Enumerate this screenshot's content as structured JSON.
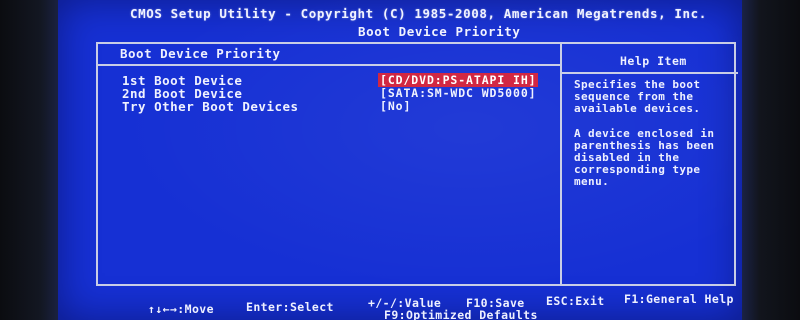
{
  "header": {
    "title": "CMOS Setup Utility - Copyright (C) 1985-2008, American Megatrends, Inc.",
    "subtitle": "Boot Device Priority"
  },
  "panel": {
    "heading": "Boot Device Priority",
    "settings": [
      {
        "label": "1st Boot Device",
        "value": "[CD/DVD:PS-ATAPI IH]",
        "selected": true
      },
      {
        "label": "2nd Boot Device",
        "value": "[SATA:SM-WDC WD5000]",
        "selected": false
      },
      {
        "label": "Try Other Boot Devices",
        "value": "[No]",
        "selected": false
      }
    ]
  },
  "help": {
    "heading": "Help Item",
    "paragraph1": [
      "Specifies the boot",
      "sequence from the",
      "available devices."
    ],
    "paragraph2": [
      "A device enclosed in",
      "parenthesis has been",
      "disabled in the",
      "corresponding type",
      "menu."
    ]
  },
  "keys": {
    "move": "↑↓←→:Move",
    "enter": "Enter:Select",
    "value": "+/-/:Value",
    "save": "F10:Save",
    "exit": "ESC:Exit",
    "help": "F1:General Help",
    "defaults": "F9:Optimized Defaults"
  },
  "colors": {
    "background": "#1630d4",
    "selection": "#d0203c",
    "text": "#eef0ff"
  }
}
